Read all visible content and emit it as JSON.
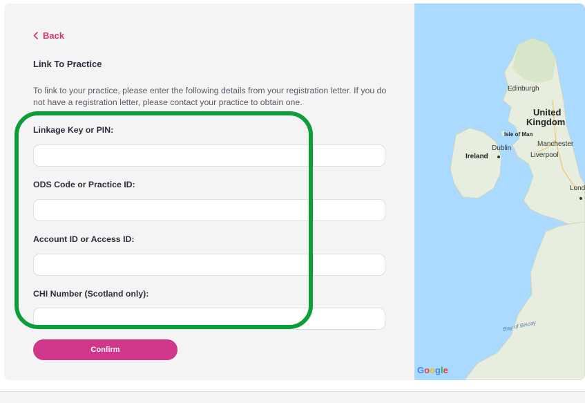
{
  "back": {
    "label": "Back"
  },
  "title": "Link To Practice",
  "description": "To link to your practice, please enter the following details from your registration letter. If you do not have a registration letter, please contact your practice to obtain one.",
  "fields": [
    {
      "label": "Linkage Key or PIN:",
      "value": "",
      "placeholder": ""
    },
    {
      "label": "ODS Code or Practice ID:",
      "value": "",
      "placeholder": ""
    },
    {
      "label": "Account ID or Access ID:",
      "value": "",
      "placeholder": ""
    },
    {
      "label": "CHI Number (Scotland only):",
      "value": "",
      "placeholder": ""
    }
  ],
  "confirm_label": "Confirm",
  "map": {
    "labels": {
      "edinburgh": "Edinburgh",
      "united": "United",
      "kingdom": "Kingdom",
      "isle_of_man": "Isle of Man",
      "dublin": "Dublin",
      "ireland": "Ireland",
      "manchester": "Manchester",
      "liverpool": "Liverpool",
      "london": "Lond",
      "bay_of_biscay": "Bay of Biscay"
    },
    "attribution": [
      "G",
      "o",
      "o",
      "g",
      "l",
      "e"
    ]
  },
  "colors": {
    "accent": "#d6336c",
    "confirm_button": "#d0368a",
    "highlight": "#0f9d3a",
    "water": "#aadaff",
    "land": "#e8eedf"
  }
}
